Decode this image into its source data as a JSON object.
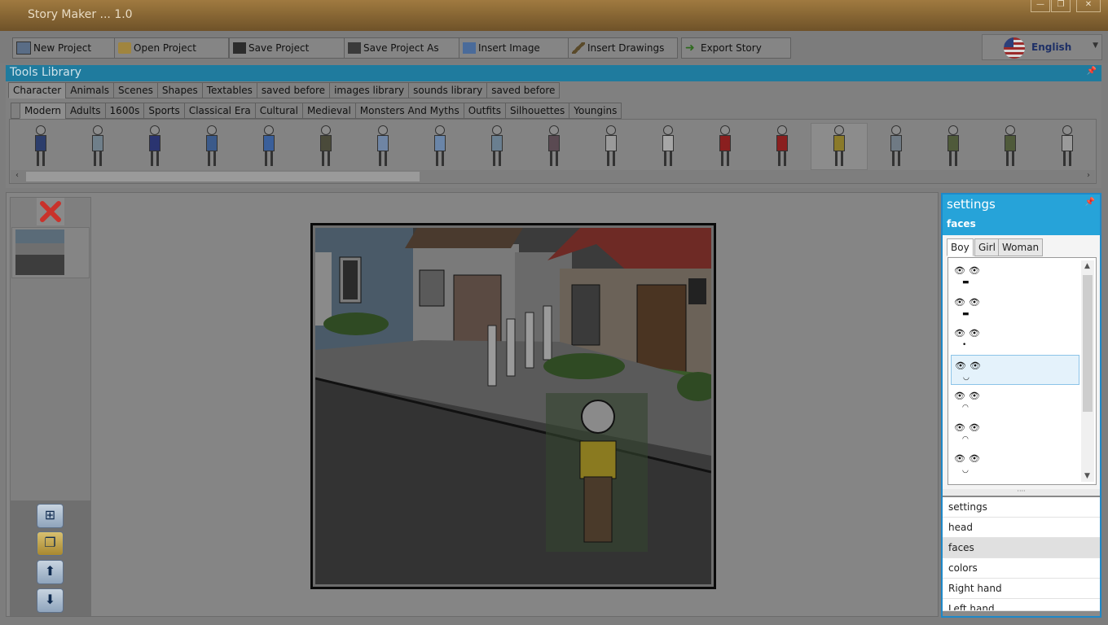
{
  "window": {
    "title": "Story Maker ... 1.0"
  },
  "toolbar": {
    "buttons": [
      {
        "label": "New Project",
        "icon": "new-project-icon"
      },
      {
        "label": "Open Project",
        "icon": "folder-icon"
      },
      {
        "label": "Save Project",
        "icon": "floppy-icon"
      },
      {
        "label": "Save Project As",
        "icon": "floppy-as-icon"
      },
      {
        "label": "Insert Image",
        "icon": "image-icon"
      },
      {
        "label": "Insert Drawings",
        "icon": "pencil-icon"
      },
      {
        "label": "Export Story",
        "icon": "export-arrow-icon"
      }
    ],
    "language": "English"
  },
  "tools": {
    "title": "Tools Library",
    "categories": [
      "Character",
      "Animals",
      "Scenes",
      "Shapes",
      "Textables",
      "saved before",
      "images library",
      "sounds library",
      "saved before"
    ],
    "subcategories": [
      "Modern",
      "Adults",
      "1600s",
      "Sports",
      "Classical Era",
      "Cultural",
      "Medieval",
      "Monsters And Myths",
      "Outfits",
      "Silhouettes",
      "Youngins"
    ],
    "character_colors": [
      "#2c3d6b",
      "#6f7f8a",
      "#2a3470",
      "#3b5a8a",
      "#3a5f9a",
      "#4a4a3a",
      "#6f85a4",
      "#6a85a8",
      "#6a7f90",
      "#5a4a52",
      "#9a9a9a",
      "#a6a6a6",
      "#8a1f1f",
      "#8a1f1f",
      "#8a7a2a",
      "#6f7a84",
      "#4f5a3a",
      "#4f5a3a",
      "#9a9a9a"
    ]
  },
  "settings": {
    "title": "settings",
    "section": "faces",
    "face_tabs": [
      "Boy",
      "Girl",
      "Woman"
    ],
    "faces": [
      {
        "eyes": "👁👁",
        "mouth": "▬"
      },
      {
        "eyes": "👁👁",
        "mouth": "▬"
      },
      {
        "eyes": "👁👁",
        "mouth": "•"
      },
      {
        "eyes": "👁👁",
        "mouth": "◡"
      },
      {
        "eyes": "👁👁",
        "mouth": "◠"
      },
      {
        "eyes": "👁👁",
        "mouth": "◠"
      },
      {
        "eyes": "👁👁",
        "mouth": "◡"
      }
    ],
    "selected_face": 3,
    "nav": [
      "settings",
      "head",
      "faces",
      "colors",
      "Right hand",
      "Left hand"
    ],
    "nav_selected": 2
  }
}
